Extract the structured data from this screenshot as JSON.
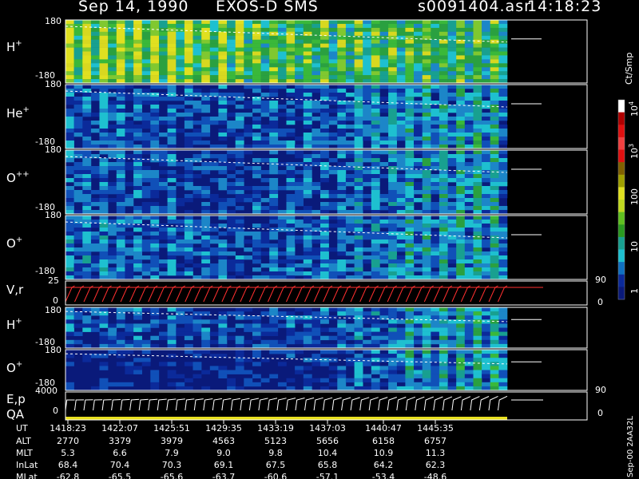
{
  "header": {
    "date": "Sep 14, 1990",
    "instrument": "EXOS-D SMS",
    "file": "s0091404.asr",
    "time": "14:18:23"
  },
  "colorbar": {
    "unit": "Ct/Smp",
    "labels": [
      "10",
      "4",
      "10",
      "3",
      "100",
      "10",
      "1"
    ]
  },
  "panels": [
    {
      "label": "H",
      "charge": "+",
      "ymax": "180",
      "ymin": "-180"
    },
    {
      "label": "He",
      "charge": "+",
      "ymax": "180",
      "ymin": "-180"
    },
    {
      "label": "O",
      "charge": "++",
      "ymax": "180",
      "ymin": "-180"
    },
    {
      "label": "O",
      "charge": "+",
      "ymax": "180",
      "ymin": "-180"
    },
    {
      "label": "V,r",
      "charge": "",
      "ymax": "25",
      "ymin": "0",
      "rmax": "90",
      "rmin": "0"
    },
    {
      "label": "H",
      "charge": "+",
      "ymax": "180",
      "ymin": "-180"
    },
    {
      "label": "O",
      "charge": "+",
      "ymax": "180",
      "ymin": "-180"
    },
    {
      "label": "E,p",
      "label2": "QA",
      "charge": "",
      "ymax": "4000",
      "ymin": "0",
      "rmax": "90",
      "rmin": "0"
    }
  ],
  "footer": {
    "row_labels": [
      "UT",
      "ALT",
      "MLT",
      "InLat",
      "MLat"
    ],
    "ut": [
      "1418:23",
      "1422:07",
      "1425:51",
      "1429:35",
      "1433:19",
      "1437:03",
      "1440:47",
      "1445:35"
    ],
    "alt": [
      "2770",
      "3379",
      "3979",
      "4563",
      "5123",
      "5656",
      "6158",
      "6757"
    ],
    "mlt": [
      "5.3",
      "6.6",
      "7.9",
      "9.0",
      "9.8",
      "10.4",
      "10.9",
      "11.3"
    ],
    "inlat": [
      "68.4",
      "70.4",
      "70.3",
      "69.1",
      "67.5",
      "65.8",
      "64.2",
      "62.3"
    ],
    "mlat": [
      "-62.8",
      "-65.5",
      "-65.6",
      "-63.7",
      "-60.6",
      "-57.1",
      "-53.4",
      "-48.6"
    ]
  },
  "side_note": "Sep-00 2AA32L",
  "chart_data": {
    "type": "heatmap",
    "title": "Sep 14, 1990    EXOS-D SMS",
    "x_ticks": [
      "1418:23",
      "1422:07",
      "1425:51",
      "1429:35",
      "1433:19",
      "1437:03",
      "1440:47",
      "1445:35"
    ],
    "panels": [
      {
        "name": "H+",
        "ylim": [
          -180,
          180
        ],
        "activity": [
          0.92,
          0.9,
          0.85,
          0.8,
          0.75,
          0.7,
          0.7,
          0.72
        ]
      },
      {
        "name": "He+",
        "ylim": [
          -180,
          180
        ],
        "activity": [
          0.35,
          0.3,
          0.28,
          0.3,
          0.35,
          0.45,
          0.55,
          0.6
        ]
      },
      {
        "name": "O++",
        "ylim": [
          -180,
          180
        ],
        "activity": [
          0.35,
          0.3,
          0.25,
          0.25,
          0.3,
          0.4,
          0.5,
          0.55
        ]
      },
      {
        "name": "O+",
        "ylim": [
          -180,
          180
        ],
        "activity": [
          0.4,
          0.35,
          0.3,
          0.3,
          0.35,
          0.45,
          0.55,
          0.6
        ]
      },
      {
        "name": "V,r",
        "ylim": [
          0,
          25
        ],
        "right_ylim": [
          0,
          90
        ]
      },
      {
        "name": "H+",
        "ylim": [
          -180,
          180
        ],
        "activity": [
          0.3,
          0.28,
          0.25,
          0.25,
          0.28,
          0.4,
          0.55,
          0.65
        ]
      },
      {
        "name": "O+",
        "ylim": [
          -180,
          180
        ],
        "activity": [
          0.1,
          0.1,
          0.1,
          0.12,
          0.18,
          0.35,
          0.55,
          0.65
        ]
      },
      {
        "name": "E,p",
        "ylim": [
          0,
          4000
        ],
        "right_ylim": [
          0,
          90
        ]
      }
    ],
    "colorbar_range": [
      1,
      10000
    ],
    "colorbar_scale": "log",
    "colors": {
      "background": "#000000",
      "low": "#0a1a7a",
      "cyan": "#1ec0d0",
      "green": "#3ab83a",
      "yellow": "#e0e020",
      "red": "#e01010",
      "trace": "#ff3030",
      "qa": "#e8e020"
    }
  }
}
